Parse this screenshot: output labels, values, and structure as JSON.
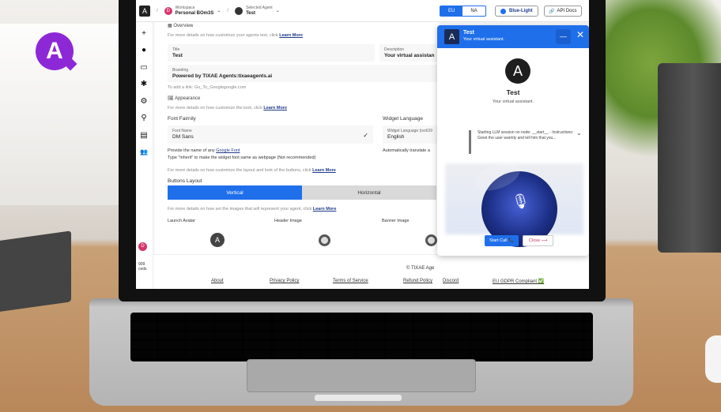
{
  "brand_badge": {
    "letter": "A"
  },
  "topbar": {
    "logo_letter": "A",
    "separator": "/",
    "workspace_initial": "D",
    "workspace_label": "Workspace",
    "workspace_name": "Personal BOm3S",
    "agent_label": "Selected Agent",
    "agent_name": "Test",
    "region_eu": "EU",
    "region_na": "NA",
    "theme": "Blue-Light",
    "api_docs": "API Docs",
    "chevron": "⌄"
  },
  "sidebar": {
    "items": [
      "+",
      "●",
      "▭",
      "✱",
      "⚙",
      "⚲",
      "▤",
      "👥"
    ],
    "user_initial": "D",
    "credits_number": "909",
    "credits_label": "ceds"
  },
  "overview": {
    "heading": "Overview",
    "hint": "For more details on how customize your agents text, click",
    "hint_link": "Learn More",
    "title_label": "Title",
    "title_value": "Test",
    "description_label": "Description",
    "description_value": "Your virtual assistan",
    "branding_label": "Branding",
    "branding_value": "Powered by TIXAE Agents:tixaeagents.ai",
    "add_link_hint": "To add a link: Go_To_Googlegoogle.com"
  },
  "appearance": {
    "heading": "Appearance",
    "hint": "For more details on how customize the look, click",
    "hint_link": "Learn More",
    "font_family_label": "Font Fairnily",
    "font_name_label": "Font Name",
    "font_name_value": "DM Sans",
    "widget_language_label": "Widget Language",
    "widget_language_field_label": "Widget Language (iso639",
    "widget_language_value": "English",
    "font_hint_prefix": "Provide the name of any",
    "font_hint_link": "Google Font",
    "font_hint_inherit": "Type \"inherit\" to make the widget font same as webpage (Not recommended)",
    "auto_translate": "Automatically translate a",
    "layout_hint": "For more details on how customize the layout and look of the buttons, click",
    "layout_hint_link": "Learn More",
    "buttons_layout_label": "Buttons Layout",
    "layout_vertical": "Vertical",
    "layout_horizontal": "Horizontal",
    "images_hint": "For more details on how set the images that will represent your agent, click",
    "images_hint_link": "Learn More",
    "launch_avatar_label": "Launch Avatar",
    "header_image_label": "Header Image",
    "banner_image_label": "Banner Image",
    "avatar_letter": "A"
  },
  "footer": {
    "copyright": "© TIXAE Age",
    "links": [
      "About",
      "Privacy Policy",
      "Terms of Service",
      "Refund Policy",
      "Discord",
      "EU GDPR Compliant ✅"
    ]
  },
  "widget": {
    "header_title": "Test",
    "header_subtitle": "Your virtual assistant.",
    "header_avatar": "A",
    "minimize": "—",
    "close": "✕",
    "logo_letter": "A",
    "name": "Test",
    "subtitle": "Your virtual assistant.",
    "log_text": "Starting LLM session on node: __start__ - Instructions: Greet the user warmly and tell him that you...",
    "expand": "⌄",
    "mic": "🎙",
    "start_call": "Start Call 📞",
    "close_button": "Close ⟶"
  }
}
